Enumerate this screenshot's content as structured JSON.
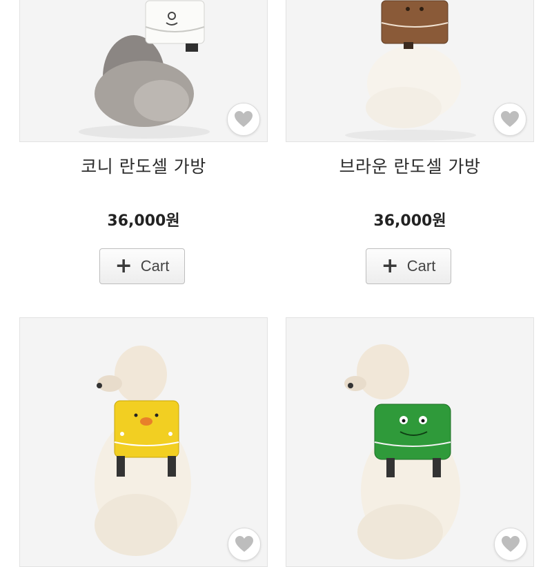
{
  "products": [
    {
      "name": "코니 란도셀 가방",
      "price": "36,000원",
      "cart_label": "Cart",
      "bag_color": "#f4f4f2",
      "icon": "heart-icon"
    },
    {
      "name": "브라운 란도셀 가방",
      "price": "36,000원",
      "cart_label": "Cart",
      "bag_color": "#8a5a38",
      "icon": "heart-icon"
    },
    {
      "name": "",
      "price": "",
      "cart_label": "",
      "bag_color": "#f2cf22",
      "icon": "heart-icon"
    },
    {
      "name": "",
      "price": "",
      "cart_label": "",
      "bag_color": "#2f9a3a",
      "icon": "heart-icon"
    }
  ]
}
